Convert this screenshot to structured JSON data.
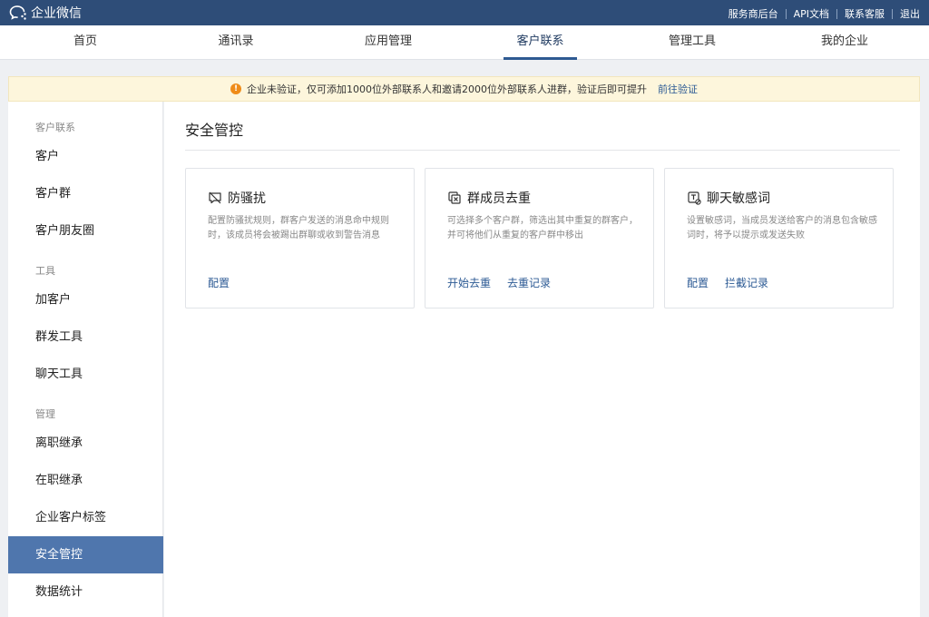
{
  "brand": {
    "name": "企业微信",
    "icon": "chat-bubble-icon"
  },
  "top_links": [
    "服务商后台",
    "API文档",
    "联系客服",
    "退出"
  ],
  "main_nav": {
    "tabs": [
      "首页",
      "通讯录",
      "应用管理",
      "客户联系",
      "管理工具",
      "我的企业"
    ],
    "active": "客户联系"
  },
  "notice": {
    "text": "企业未验证，仅可添加1000位外部联系人和邀请2000位外部联系人进群，验证后即可提升",
    "link": "前往验证",
    "icon_glyph": "!",
    "icon": "warning-icon"
  },
  "sidebar": {
    "groups": [
      {
        "title": "客户联系",
        "items": [
          "客户",
          "客户群",
          "客户朋友圈"
        ]
      },
      {
        "title": "工具",
        "items": [
          "加客户",
          "群发工具",
          "聊天工具"
        ]
      },
      {
        "title": "管理",
        "items": [
          "离职继承",
          "在职继承",
          "企业客户标签",
          "安全管控",
          "数据统计"
        ]
      }
    ],
    "active": "安全管控"
  },
  "page": {
    "title": "安全管控"
  },
  "cards": [
    {
      "icon": "anti-harass-icon",
      "title": "防骚扰",
      "desc": "配置防骚扰规则，群客户发送的消息命中规则时，该成员将会被踢出群聊或收到警告消息",
      "actions": [
        "配置"
      ]
    },
    {
      "icon": "dedupe-icon",
      "title": "群成员去重",
      "desc": "可选择多个客户群，筛选出其中重复的群客户，并可将他们从重复的客户群中移出",
      "actions": [
        "开始去重",
        "去重记录"
      ]
    },
    {
      "icon": "sensitive-words-icon",
      "title": "聊天敏感词",
      "desc": "设置敏感词，当成员发送给客户的消息包含敏感词时，将予以提示或发送失败",
      "actions": [
        "配置",
        "拦截记录"
      ]
    }
  ],
  "colors": {
    "topbar": "#2e4d78",
    "accent": "#4f76ad",
    "link": "#2c5a94",
    "warning": "#ef8c19"
  }
}
